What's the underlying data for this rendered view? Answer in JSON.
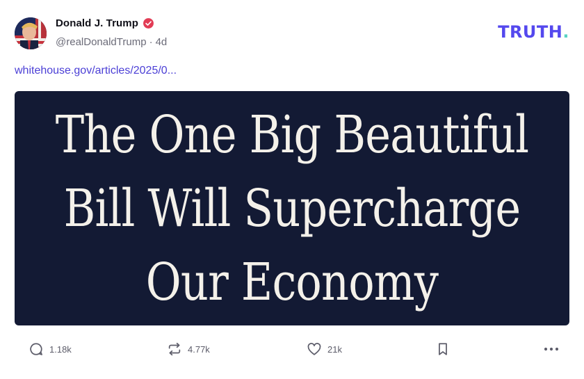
{
  "post": {
    "author": {
      "name": "Donald J. Trump",
      "handle": "@realDonaldTrump",
      "separator": "·",
      "age": "4d",
      "verified_icon": "verified-badge-icon",
      "avatar_icon": "avatar"
    },
    "brand": {
      "logo_text": "TRUTH",
      "logo_dot": ".",
      "color": "#5448ee",
      "dot_color": "#59d3c3"
    },
    "link": {
      "text": "whitehouse.gov/articles/2025/0..."
    },
    "media": {
      "background": "#131a34",
      "headline_lines": [
        "The One Big Beautiful",
        "Bill Will Supercharge",
        "Our Economy"
      ]
    },
    "actions": {
      "replies": {
        "icon": "reply-icon",
        "count": "1.18k"
      },
      "retruths": {
        "icon": "retruth-icon",
        "count": "4.77k"
      },
      "likes": {
        "icon": "heart-icon",
        "count": "21k"
      },
      "bookmark": {
        "icon": "bookmark-icon"
      },
      "more": {
        "icon": "more-icon"
      }
    }
  }
}
